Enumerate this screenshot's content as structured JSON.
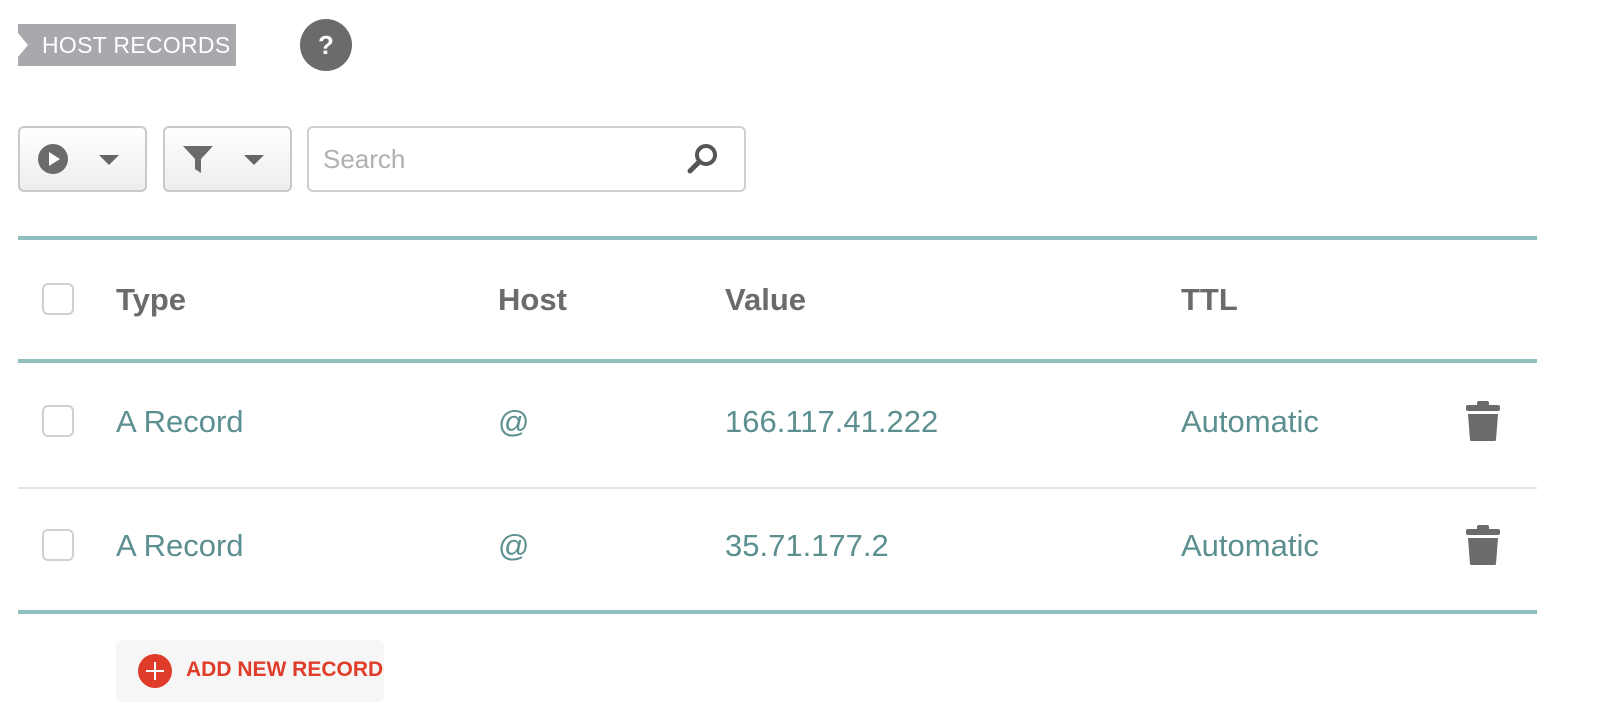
{
  "header": {
    "section_title": "HOST RECORDS",
    "help_label": "?"
  },
  "toolbar": {
    "actions_icon": "play-circle-icon",
    "filter_icon": "filter-funnel-icon",
    "search_placeholder": "Search",
    "search_value": ""
  },
  "table": {
    "columns": [
      "Type",
      "Host",
      "Value",
      "TTL"
    ],
    "rows": [
      {
        "type": "A Record",
        "host": "@",
        "value": "166.117.41.222",
        "ttl": "Automatic"
      },
      {
        "type": "A Record",
        "host": "@",
        "value": "35.71.177.2",
        "ttl": "Automatic"
      }
    ]
  },
  "add_record": {
    "label": "ADD NEW RECORD"
  },
  "colors": {
    "accent_teal": "#8fbfbf",
    "value_text": "#5c8f8f",
    "add_red": "#e03c2a",
    "tag_gray": "#a7a9ac"
  }
}
